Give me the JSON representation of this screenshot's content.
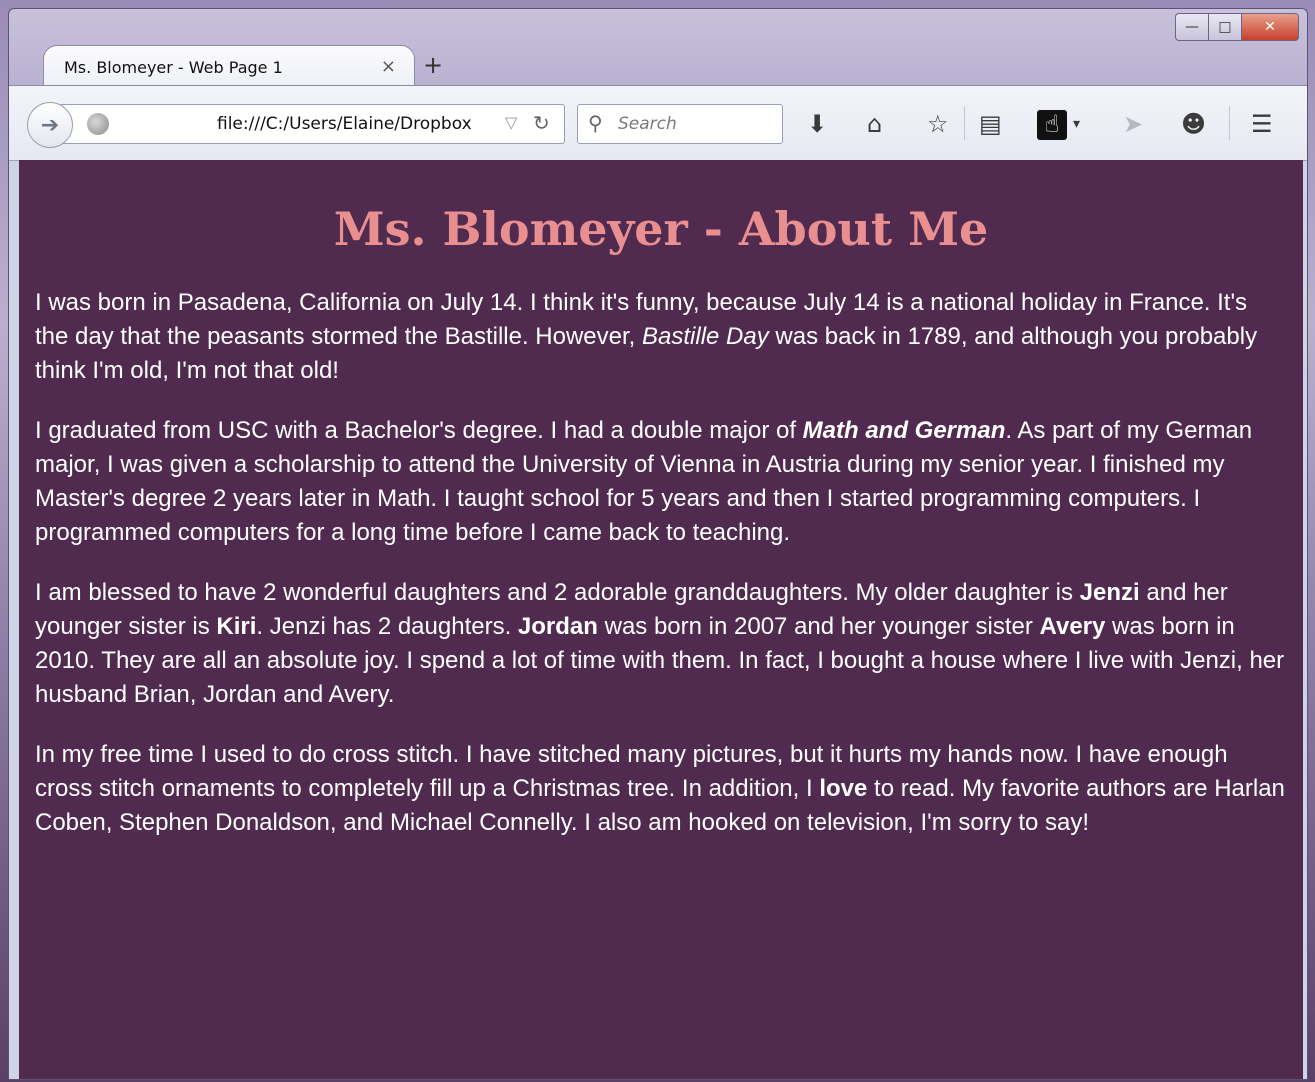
{
  "browser": {
    "tab_title": "Ms. Blomeyer - Web Page 1",
    "tab_close": "×",
    "new_tab": "+",
    "url": "file:///C:/Users/Elaine/Dropbox",
    "search_placeholder": "Search"
  },
  "icons": {
    "back": "back-arrow-icon",
    "globe": "globe-icon",
    "dropdown": "url-dropdown-icon",
    "reload": "reload-icon",
    "search": "search-icon",
    "download": "download-icon",
    "home": "home-icon",
    "bookmark": "star-icon",
    "reading_list": "clipboard-icon",
    "hand": "hand-cursor-icon",
    "send": "send-icon",
    "chat": "chat-icon",
    "menu": "hamburger-menu-icon"
  },
  "page": {
    "title": "Ms. Blomeyer - About Me",
    "p1": {
      "a": "I was born in Pasadena, California on July 14. I think it's funny, because July 14 is a national holiday in France. It's the day that the peasants stormed the Bastille. However, ",
      "b_italic": "Bastille Day",
      "c": " was back in 1789, and although you probably think I'm old, I'm not that old!"
    },
    "p2": {
      "a": "I graduated from USC with a Bachelor's degree. I had a double major of ",
      "b_bolditalic": "Math and German",
      "c": ". As part of my German major, I was given a scholarship to attend the University of Vienna in Austria during my senior year. I finished my Master's degree 2 years later in Math. I taught school for 5 years and then I started programming computers. I programmed computers for a long time before I came back to teaching."
    },
    "p3": {
      "a": "I am blessed to have 2 wonderful daughters and 2 adorable granddaughters. My older daughter is ",
      "jenzi": "Jenzi",
      "b": " and her younger sister is ",
      "kiri": "Kiri",
      "c": ". Jenzi has 2 daughters. ",
      "jordan": "Jordan",
      "d": " was born in 2007 and her younger sister ",
      "avery": "Avery",
      "e": " was born in 2010. They are all an absolute joy. I spend a lot of time with them. In fact, I bought a house where I live with Jenzi, her husband Brian, Jordan and Avery."
    },
    "p4": {
      "a": "In my free time I used to do cross stitch. I have stitched many pictures, but it hurts my hands now. I have enough cross stitch ornaments to completely fill up a Christmas tree. In addition, I ",
      "love": "love",
      "b": " to read. My favorite authors are Harlan Coben, Stephen Donaldson, and Michael Connelly. I also am hooked on television, I'm sorry to say!"
    }
  },
  "colors": {
    "page_bg": "#512b4f",
    "title": "#ea8f8f",
    "text": "#ffffff"
  }
}
